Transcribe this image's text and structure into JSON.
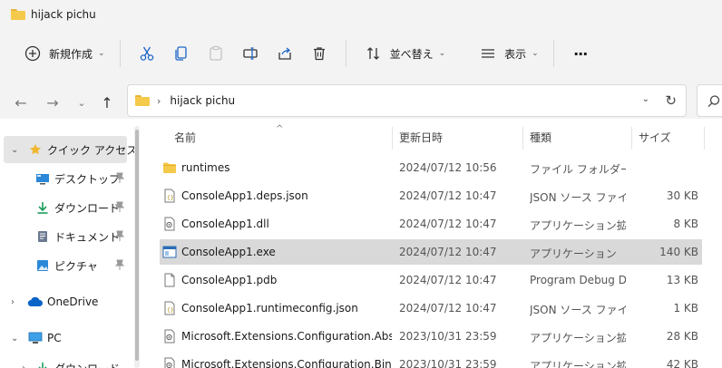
{
  "window": {
    "title": "hijack pichu"
  },
  "toolbar": {
    "new_label": "新規作成",
    "sort_label": "並べ替え",
    "view_label": "表示",
    "more_label": "···"
  },
  "address": {
    "crumb_sep": "›",
    "path": "hijack pichu",
    "dropdown": "⌄",
    "refresh": "↻"
  },
  "nav_buttons": {
    "back": "←",
    "forward": "→",
    "recent": "⌄",
    "up": "↑"
  },
  "sidebar": {
    "items": [
      {
        "label": "クイック アクセス",
        "expander": "⌄"
      },
      {
        "label": "デスクトップ",
        "pin": "📌"
      },
      {
        "label": "ダウンロード",
        "pin": "📌"
      },
      {
        "label": "ドキュメント",
        "pin": "📌"
      },
      {
        "label": "ピクチャ",
        "pin": "📌"
      },
      {
        "label": "OneDrive",
        "expander": "›"
      },
      {
        "label": "PC",
        "expander": "⌄"
      },
      {
        "label": "ダウンロード"
      }
    ]
  },
  "columns": {
    "name": "名前",
    "date": "更新日時",
    "type": "種類",
    "size": "サイズ"
  },
  "files": [
    {
      "name": "runtimes",
      "date": "2024/07/12 10:56",
      "type": "ファイル フォルダー",
      "size": "",
      "icon": "folder-icon"
    },
    {
      "name": "ConsoleApp1.deps.json",
      "date": "2024/07/12 10:47",
      "type": "JSON ソース ファイル",
      "size": "30 KB",
      "icon": "json-file-icon"
    },
    {
      "name": "ConsoleApp1.dll",
      "date": "2024/07/12 10:47",
      "type": "アプリケーション拡張",
      "size": "8 KB",
      "icon": "dll-file-icon"
    },
    {
      "name": "ConsoleApp1.exe",
      "date": "2024/07/12 10:47",
      "type": "アプリケーション",
      "size": "140 KB",
      "icon": "exe-file-icon",
      "selected": true
    },
    {
      "name": "ConsoleApp1.pdb",
      "date": "2024/07/12 10:47",
      "type": "Program Debug D...",
      "size": "13 KB",
      "icon": "blank-file-icon"
    },
    {
      "name": "ConsoleApp1.runtimeconfig.json",
      "date": "2024/07/12 10:47",
      "type": "JSON ソース ファイル",
      "size": "1 KB",
      "icon": "json-file-icon"
    },
    {
      "name": "Microsoft.Extensions.Configuration.Abstr...",
      "date": "2023/10/31 23:59",
      "type": "アプリケーション拡張",
      "size": "28 KB",
      "icon": "dll-file-icon"
    },
    {
      "name": "Microsoft.Extensions.Configuration.Bind...",
      "date": "2023/10/31 23:59",
      "type": "アプリケーション拡張",
      "size": "42 KB",
      "icon": "dll-file-icon"
    }
  ],
  "colors": {
    "accent": "#0067c0",
    "folder": "#f5c94a",
    "selection": "#d9d9d9"
  }
}
